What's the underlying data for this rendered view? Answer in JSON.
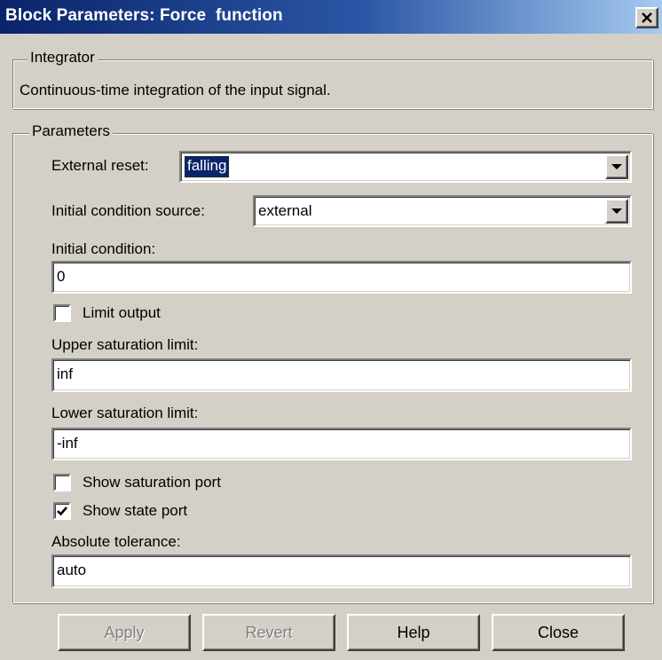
{
  "window": {
    "title": "Block Parameters: Force  function",
    "close_glyph": "✕"
  },
  "integrator": {
    "legend": "Integrator",
    "description": "Continuous-time integration of the input signal."
  },
  "parameters": {
    "legend": "Parameters",
    "external_reset": {
      "label": "External reset:",
      "value": "falling"
    },
    "initial_condition_source": {
      "label": "Initial condition source:",
      "value": "external"
    },
    "initial_condition": {
      "label": "Initial condition:",
      "value": "0"
    },
    "limit_output": {
      "label": "Limit output",
      "checked": false
    },
    "upper_saturation_limit": {
      "label": "Upper saturation limit:",
      "value": "inf"
    },
    "lower_saturation_limit": {
      "label": "Lower saturation limit:",
      "value": "-inf"
    },
    "show_saturation_port": {
      "label": "Show saturation port",
      "checked": false
    },
    "show_state_port": {
      "label": "Show state port",
      "checked": true
    },
    "absolute_tolerance": {
      "label": "Absolute tolerance:",
      "value": "auto"
    }
  },
  "buttons": {
    "apply": "Apply",
    "revert": "Revert",
    "help": "Help",
    "close": "Close"
  },
  "icons": {
    "close": "close-icon",
    "dropdown": "chevron-down-icon",
    "check": "checkmark-icon"
  }
}
